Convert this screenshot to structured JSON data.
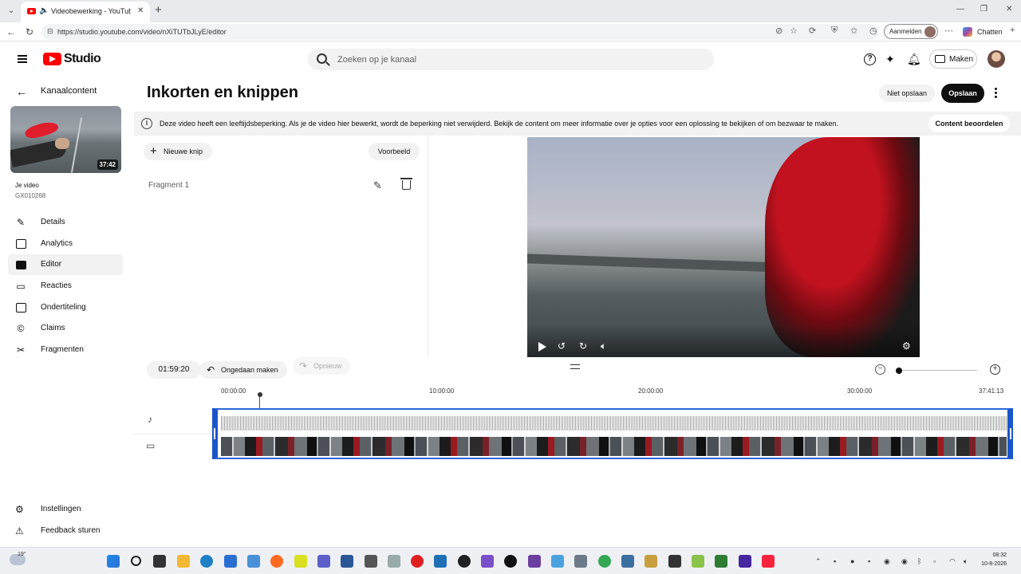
{
  "browser": {
    "tab_title": "Videobewerking - YouTube St",
    "url": "https://studio.youtube.com/video/nXiTUTbJLyE/editor",
    "signin_label": "Aanmelden",
    "copilot_label": "Chatten"
  },
  "header": {
    "logo_text": "Studio",
    "search_placeholder": "Zoeken op je kanaal",
    "create_label": "Maken"
  },
  "sidebar": {
    "title": "Kanaalcontent",
    "thumbnail_duration": "37:42",
    "video_label": "Je video",
    "video_name": "GX010268",
    "items": [
      {
        "label": "Details",
        "icon": "pencil-icon",
        "active": false
      },
      {
        "label": "Analytics",
        "icon": "analytics-icon",
        "active": false
      },
      {
        "label": "Editor",
        "icon": "editor-icon",
        "active": true
      },
      {
        "label": "Reacties",
        "icon": "comments-icon",
        "active": false
      },
      {
        "label": "Ondertiteling",
        "icon": "subtitles-icon",
        "active": false
      },
      {
        "label": "Claims",
        "icon": "copyright-icon",
        "active": false
      },
      {
        "label": "Fragmenten",
        "icon": "scissors-icon",
        "active": false
      }
    ],
    "footer": [
      {
        "label": "Instellingen",
        "icon": "gear-icon"
      },
      {
        "label": "Feedback sturen",
        "icon": "feedback-icon"
      }
    ]
  },
  "main": {
    "title": "Inkorten en knippen",
    "discard_label": "Niet opslaan",
    "save_label": "Opslaan",
    "banner_text": "Deze video heeft een leeftijdsbeperking. Als je de video hier bewerkt, wordt de beperking niet verwijderd. Bekijk de content om meer informatie over je opties voor een oplossing te bekijken of om bezwaar te maken.",
    "banner_button": "Content beoordelen",
    "new_cut_label": "Nieuwe knip",
    "preview_label": "Voorbeeld",
    "fragment_label": "Fragment 1"
  },
  "timeline": {
    "timecode": "01:59:20",
    "undo_label": "Ongedaan maken",
    "redo_label": "Opnieuw",
    "ruler_labels": [
      "00:00:00",
      "10:00:00",
      "20:00:00",
      "30:00:00",
      "37:41:13"
    ]
  },
  "taskbar": {
    "temperature": "19°",
    "time": "08:32",
    "date": "10-8-2026"
  },
  "colors": {
    "brand_red": "#ff0000",
    "timeline_blue": "#1a55c9",
    "save_button": "#0f0f0f"
  }
}
